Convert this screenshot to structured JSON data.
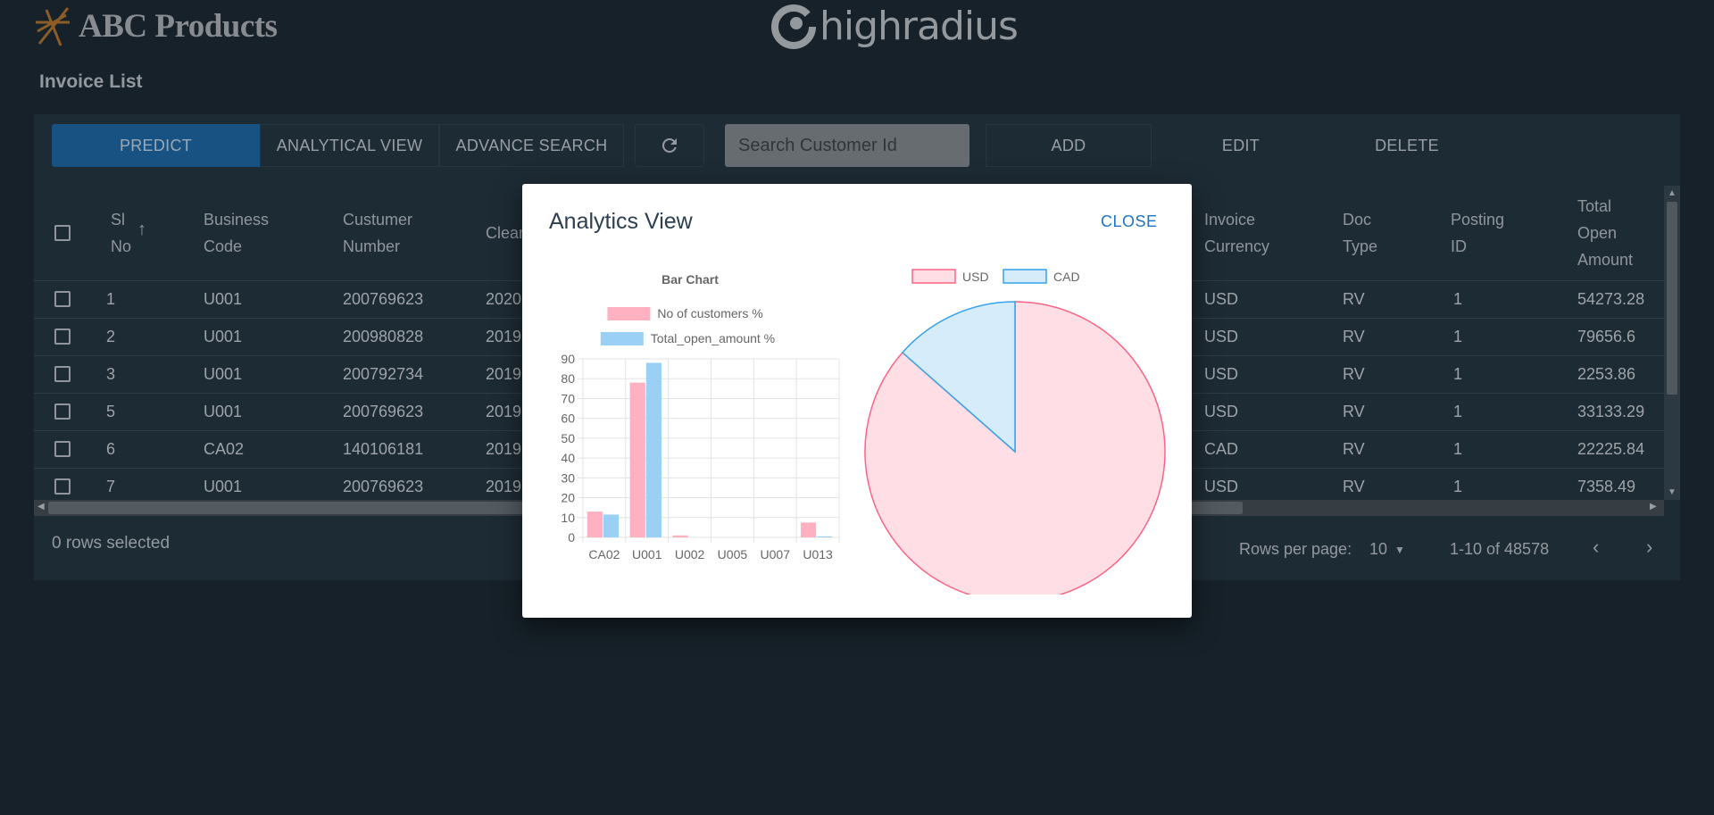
{
  "brand": {
    "name": "ABC Products",
    "logo_icon": "abc-logo-icon",
    "partner_text": "highradius"
  },
  "page_title": "Invoice List",
  "toolbar": {
    "predict": "PREDICT",
    "analytical_view": "ANALYTICAL VIEW",
    "advance_search": "ADVANCE SEARCH",
    "refresh_icon": "refresh-icon",
    "search_placeholder": "Search Customer Id",
    "add": "ADD",
    "edit": "EDIT",
    "delete": "DELETE"
  },
  "table": {
    "headers": {
      "sl_no": [
        "Sl",
        "No"
      ],
      "business_code": [
        "Business",
        "Code"
      ],
      "customer_number": [
        "Custumer",
        "Number"
      ],
      "clear": "Clear",
      "invoice_currency": [
        "Invoice",
        "Currency"
      ],
      "doc_type": [
        "Doc",
        "Type"
      ],
      "posting_id": [
        "Posting",
        "ID"
      ],
      "total_open_amount": [
        "Total",
        "Open",
        "Amount"
      ]
    },
    "rows": [
      {
        "sl_no": "1",
        "business_code": "U001",
        "customer_number": "200769623",
        "clear": "2020",
        "currency": "USD",
        "doc_type": "RV",
        "posting_id": "1",
        "amount": "54273.28"
      },
      {
        "sl_no": "2",
        "business_code": "U001",
        "customer_number": "200980828",
        "clear": "2019",
        "currency": "USD",
        "doc_type": "RV",
        "posting_id": "1",
        "amount": "79656.6"
      },
      {
        "sl_no": "3",
        "business_code": "U001",
        "customer_number": "200792734",
        "clear": "2019",
        "currency": "USD",
        "doc_type": "RV",
        "posting_id": "1",
        "amount": "2253.86"
      },
      {
        "sl_no": "5",
        "business_code": "U001",
        "customer_number": "200769623",
        "clear": "2019",
        "currency": "USD",
        "doc_type": "RV",
        "posting_id": "1",
        "amount": "33133.29"
      },
      {
        "sl_no": "6",
        "business_code": "CA02",
        "customer_number": "140106181",
        "clear": "2019",
        "currency": "CAD",
        "doc_type": "RV",
        "posting_id": "1",
        "amount": "22225.84"
      },
      {
        "sl_no": "7",
        "business_code": "U001",
        "customer_number": "200769623",
        "clear": "2019",
        "currency": "USD",
        "doc_type": "RV",
        "posting_id": "1",
        "amount": "7358.49"
      }
    ]
  },
  "footer": {
    "rows_selected": "0 rows selected",
    "rows_per_page_label": "Rows per page:",
    "rows_per_page_value": "10",
    "range": "1-10 of 48578"
  },
  "modal": {
    "title": "Analytics View",
    "close": "CLOSE"
  },
  "chart_data": [
    {
      "type": "bar",
      "title": "Bar Chart",
      "categories": [
        "CA02",
        "U001",
        "U002",
        "U005",
        "U007",
        "U013"
      ],
      "series": [
        {
          "name": "No of customers %",
          "values": [
            13,
            78,
            1,
            0,
            0,
            7.5
          ],
          "color": "#ffb1c1"
        },
        {
          "name": "Total_open_amount %",
          "values": [
            11.5,
            88,
            0,
            0,
            0,
            0.5
          ],
          "color": "#9ad0f5"
        }
      ],
      "ylim": [
        0,
        90
      ],
      "yticks": [
        0,
        10,
        20,
        30,
        40,
        50,
        60,
        70,
        80,
        90
      ],
      "grid": true,
      "legend": "top"
    },
    {
      "type": "pie",
      "slices": [
        {
          "name": "USD",
          "value": 86.5,
          "fill": "#ffdfe5",
          "stroke": "#ff6384"
        },
        {
          "name": "CAD",
          "value": 13.5,
          "fill": "#d7ecfb",
          "stroke": "#36a2eb"
        }
      ],
      "legend": "top"
    }
  ]
}
